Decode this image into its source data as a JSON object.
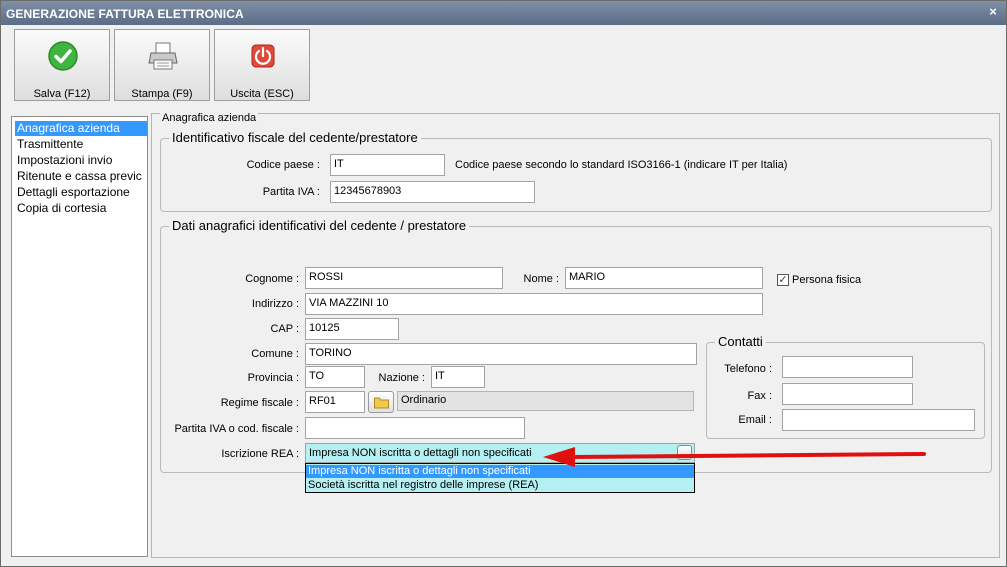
{
  "window": {
    "title": "GENERAZIONE FATTURA ELETTRONICA",
    "close_glyph": "×"
  },
  "toolbar": {
    "save_label": "Salva (F12)",
    "print_label": "Stampa (F9)",
    "exit_label": "Uscita (ESC)"
  },
  "sidebar": {
    "items": [
      {
        "label": "Anagrafica azienda",
        "selected": true
      },
      {
        "label": "Trasmittente",
        "selected": false
      },
      {
        "label": "Impostazioni invio",
        "selected": false
      },
      {
        "label": "Ritenute e cassa previc",
        "selected": false
      },
      {
        "label": "Dettagli esportazione",
        "selected": false
      },
      {
        "label": "Copia di cortesia",
        "selected": false
      }
    ]
  },
  "main": {
    "legend": "Anagrafica azienda"
  },
  "fiscal": {
    "title": "Identificativo fiscale del cedente/prestatore",
    "country_label": "Codice paese :",
    "country_value": "IT",
    "country_hint": "Codice paese secondo lo standard ISO3166-1 (indicare IT per Italia)",
    "vat_label": "Partita IVA :",
    "vat_value": "12345678903"
  },
  "registry": {
    "title": "Dati anagrafici identificativi del cedente / prestatore",
    "surname_label": "Cognome :",
    "surname_value": "ROSSI",
    "name_label": "Nome :",
    "name_value": "MARIO",
    "person_label": "Persona fisica",
    "person_checked": true,
    "address_label": "Indirizzo :",
    "address_value": "VIA MAZZINI 10",
    "cap_label": "CAP :",
    "cap_value": "10125",
    "city_label": "Comune :",
    "city_value": "TORINO",
    "province_label": "Provincia :",
    "province_value": "TO",
    "nation_label": "Nazione :",
    "nation_value": "IT",
    "regime_label": "Regime fiscale :",
    "regime_code": "RF01",
    "regime_desc": "Ordinario",
    "vat_or_cf_label": "Partita IVA o cod. fiscale :",
    "vat_or_cf_value": "",
    "rea_label": "Iscrizione REA :",
    "rea_value": "Impresa NON iscritta o dettagli non specificati",
    "rea_options": [
      "Impresa NON iscritta o dettagli non specificati",
      "Società iscritta nel registro delle imprese (REA)"
    ]
  },
  "contacts": {
    "title": "Contatti",
    "phone_label": "Telefono :",
    "phone_value": "",
    "fax_label": "Fax :",
    "fax_value": "",
    "email_label": "Email :",
    "email_value": ""
  },
  "colors": {
    "accent": "#3399ff",
    "combo_bg": "#b4eff2",
    "arrow": "#e01010",
    "titlebar": "#6b7b95"
  }
}
